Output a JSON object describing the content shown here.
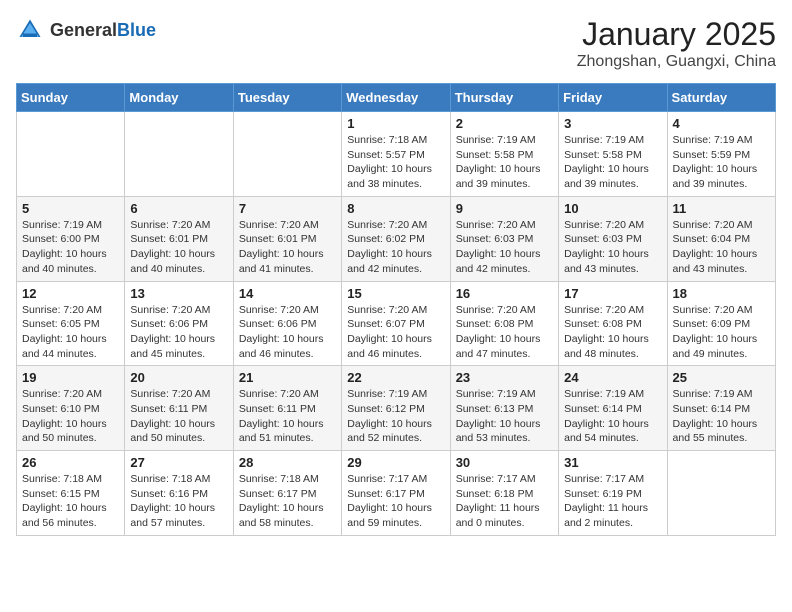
{
  "header": {
    "logo_general": "General",
    "logo_blue": "Blue",
    "month": "January 2025",
    "location": "Zhongshan, Guangxi, China"
  },
  "weekdays": [
    "Sunday",
    "Monday",
    "Tuesday",
    "Wednesday",
    "Thursday",
    "Friday",
    "Saturday"
  ],
  "weeks": [
    [
      {
        "day": "",
        "info": ""
      },
      {
        "day": "",
        "info": ""
      },
      {
        "day": "",
        "info": ""
      },
      {
        "day": "1",
        "info": "Sunrise: 7:18 AM\nSunset: 5:57 PM\nDaylight: 10 hours\nand 38 minutes."
      },
      {
        "day": "2",
        "info": "Sunrise: 7:19 AM\nSunset: 5:58 PM\nDaylight: 10 hours\nand 39 minutes."
      },
      {
        "day": "3",
        "info": "Sunrise: 7:19 AM\nSunset: 5:58 PM\nDaylight: 10 hours\nand 39 minutes."
      },
      {
        "day": "4",
        "info": "Sunrise: 7:19 AM\nSunset: 5:59 PM\nDaylight: 10 hours\nand 39 minutes."
      }
    ],
    [
      {
        "day": "5",
        "info": "Sunrise: 7:19 AM\nSunset: 6:00 PM\nDaylight: 10 hours\nand 40 minutes."
      },
      {
        "day": "6",
        "info": "Sunrise: 7:20 AM\nSunset: 6:01 PM\nDaylight: 10 hours\nand 40 minutes."
      },
      {
        "day": "7",
        "info": "Sunrise: 7:20 AM\nSunset: 6:01 PM\nDaylight: 10 hours\nand 41 minutes."
      },
      {
        "day": "8",
        "info": "Sunrise: 7:20 AM\nSunset: 6:02 PM\nDaylight: 10 hours\nand 42 minutes."
      },
      {
        "day": "9",
        "info": "Sunrise: 7:20 AM\nSunset: 6:03 PM\nDaylight: 10 hours\nand 42 minutes."
      },
      {
        "day": "10",
        "info": "Sunrise: 7:20 AM\nSunset: 6:03 PM\nDaylight: 10 hours\nand 43 minutes."
      },
      {
        "day": "11",
        "info": "Sunrise: 7:20 AM\nSunset: 6:04 PM\nDaylight: 10 hours\nand 43 minutes."
      }
    ],
    [
      {
        "day": "12",
        "info": "Sunrise: 7:20 AM\nSunset: 6:05 PM\nDaylight: 10 hours\nand 44 minutes."
      },
      {
        "day": "13",
        "info": "Sunrise: 7:20 AM\nSunset: 6:06 PM\nDaylight: 10 hours\nand 45 minutes."
      },
      {
        "day": "14",
        "info": "Sunrise: 7:20 AM\nSunset: 6:06 PM\nDaylight: 10 hours\nand 46 minutes."
      },
      {
        "day": "15",
        "info": "Sunrise: 7:20 AM\nSunset: 6:07 PM\nDaylight: 10 hours\nand 46 minutes."
      },
      {
        "day": "16",
        "info": "Sunrise: 7:20 AM\nSunset: 6:08 PM\nDaylight: 10 hours\nand 47 minutes."
      },
      {
        "day": "17",
        "info": "Sunrise: 7:20 AM\nSunset: 6:08 PM\nDaylight: 10 hours\nand 48 minutes."
      },
      {
        "day": "18",
        "info": "Sunrise: 7:20 AM\nSunset: 6:09 PM\nDaylight: 10 hours\nand 49 minutes."
      }
    ],
    [
      {
        "day": "19",
        "info": "Sunrise: 7:20 AM\nSunset: 6:10 PM\nDaylight: 10 hours\nand 50 minutes."
      },
      {
        "day": "20",
        "info": "Sunrise: 7:20 AM\nSunset: 6:11 PM\nDaylight: 10 hours\nand 50 minutes."
      },
      {
        "day": "21",
        "info": "Sunrise: 7:20 AM\nSunset: 6:11 PM\nDaylight: 10 hours\nand 51 minutes."
      },
      {
        "day": "22",
        "info": "Sunrise: 7:19 AM\nSunset: 6:12 PM\nDaylight: 10 hours\nand 52 minutes."
      },
      {
        "day": "23",
        "info": "Sunrise: 7:19 AM\nSunset: 6:13 PM\nDaylight: 10 hours\nand 53 minutes."
      },
      {
        "day": "24",
        "info": "Sunrise: 7:19 AM\nSunset: 6:14 PM\nDaylight: 10 hours\nand 54 minutes."
      },
      {
        "day": "25",
        "info": "Sunrise: 7:19 AM\nSunset: 6:14 PM\nDaylight: 10 hours\nand 55 minutes."
      }
    ],
    [
      {
        "day": "26",
        "info": "Sunrise: 7:18 AM\nSunset: 6:15 PM\nDaylight: 10 hours\nand 56 minutes."
      },
      {
        "day": "27",
        "info": "Sunrise: 7:18 AM\nSunset: 6:16 PM\nDaylight: 10 hours\nand 57 minutes."
      },
      {
        "day": "28",
        "info": "Sunrise: 7:18 AM\nSunset: 6:17 PM\nDaylight: 10 hours\nand 58 minutes."
      },
      {
        "day": "29",
        "info": "Sunrise: 7:17 AM\nSunset: 6:17 PM\nDaylight: 10 hours\nand 59 minutes."
      },
      {
        "day": "30",
        "info": "Sunrise: 7:17 AM\nSunset: 6:18 PM\nDaylight: 11 hours\nand 0 minutes."
      },
      {
        "day": "31",
        "info": "Sunrise: 7:17 AM\nSunset: 6:19 PM\nDaylight: 11 hours\nand 2 minutes."
      },
      {
        "day": "",
        "info": ""
      }
    ]
  ]
}
